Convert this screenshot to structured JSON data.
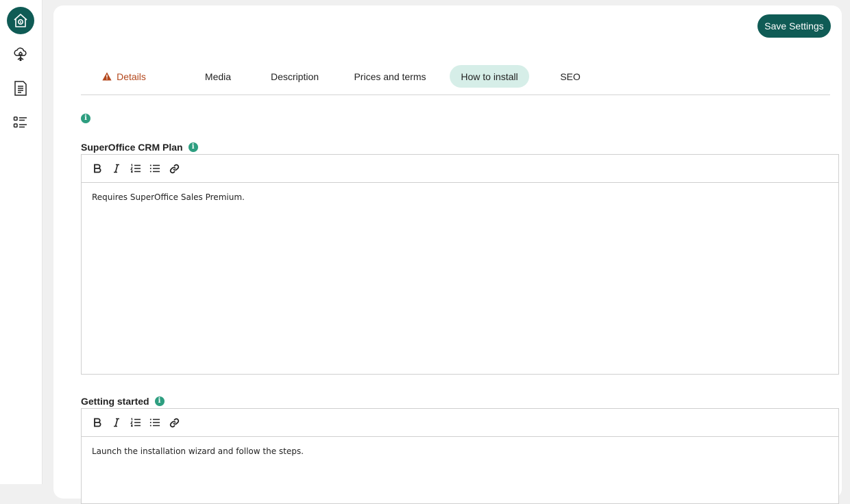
{
  "sidebar": {
    "items": [
      {
        "icon": "home-icon",
        "active": true
      },
      {
        "icon": "cloud-network-icon",
        "active": false
      },
      {
        "icon": "document-icon",
        "active": false
      },
      {
        "icon": "checklist-icon",
        "active": false
      }
    ]
  },
  "header": {
    "save_label": "Save Settings"
  },
  "tabs": [
    {
      "label": "Details",
      "warning": true
    },
    {
      "label": "Media"
    },
    {
      "label": "Description"
    },
    {
      "label": "Prices and terms"
    },
    {
      "label": "How to install",
      "active": true
    },
    {
      "label": "SEO"
    }
  ],
  "fields": [
    {
      "label": "SuperOffice CRM Plan",
      "content": "Requires SuperOffice Sales Premium."
    },
    {
      "label": "Getting started",
      "content": "Launch the installation wizard and follow the steps."
    }
  ],
  "info_glyph": "i",
  "colors": {
    "brand": "#0f5b55",
    "tab_active_bg": "#d6eee8",
    "warning": "#b3471c",
    "info": "#2e9e80"
  }
}
